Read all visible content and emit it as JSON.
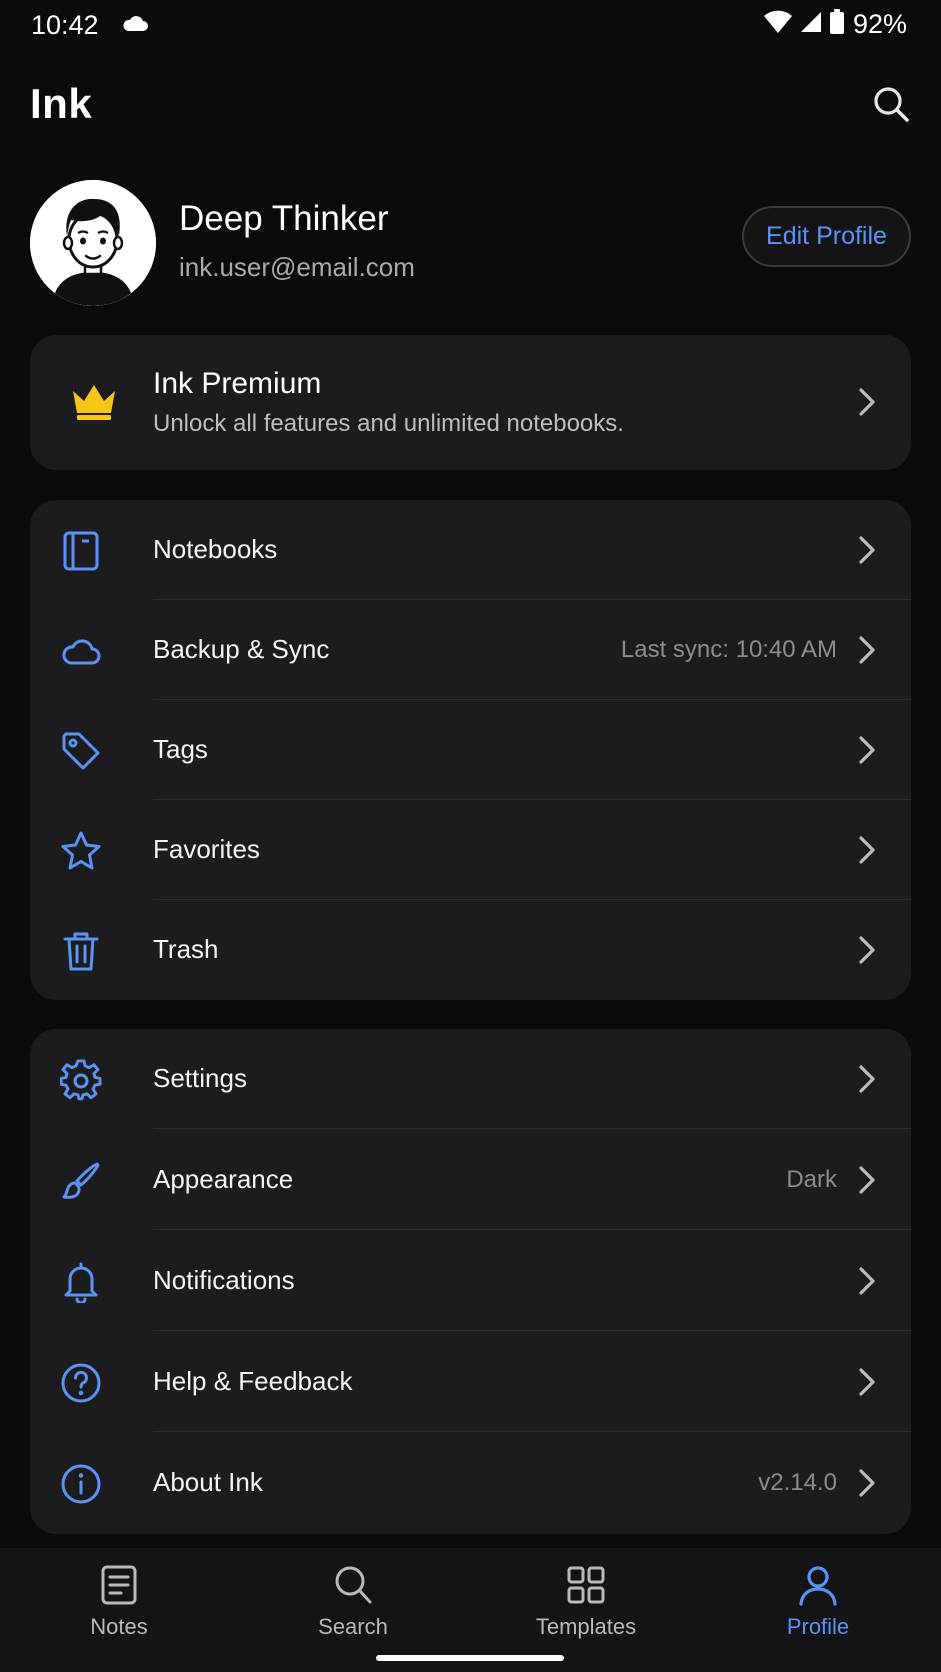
{
  "status_bar": {
    "time": "10:42",
    "battery": "92%"
  },
  "header": {
    "title": "Ink"
  },
  "profile": {
    "name": "Deep Thinker",
    "email": "ink.user@email.com",
    "edit_label": "Edit Profile"
  },
  "premium": {
    "title": "Ink Premium",
    "subtitle": "Unlock all features and unlimited notebooks."
  },
  "library": [
    {
      "label": "Notebooks",
      "value": "",
      "icon": "notebook-icon"
    },
    {
      "label": "Backup & Sync",
      "value": "Last sync: 10:40 AM",
      "icon": "cloud-icon"
    },
    {
      "label": "Tags",
      "value": "",
      "icon": "tag-icon"
    },
    {
      "label": "Favorites",
      "value": "",
      "icon": "star-icon"
    },
    {
      "label": "Trash",
      "value": "",
      "icon": "trash-icon"
    }
  ],
  "settings": [
    {
      "label": "Settings",
      "value": "",
      "icon": "gear-icon"
    },
    {
      "label": "Appearance",
      "value": "Dark",
      "icon": "brush-icon"
    },
    {
      "label": "Notifications",
      "value": "",
      "icon": "bell-icon"
    },
    {
      "label": "Help & Feedback",
      "value": "",
      "icon": "help-icon"
    },
    {
      "label": "About Ink",
      "value": "v2.14.0",
      "icon": "info-icon"
    }
  ],
  "bottom_nav": [
    {
      "label": "Notes",
      "icon": "notes-icon",
      "active": false
    },
    {
      "label": "Search",
      "icon": "search-icon",
      "active": false
    },
    {
      "label": "Templates",
      "icon": "grid-icon",
      "active": false
    },
    {
      "label": "Profile",
      "icon": "person-icon",
      "active": true
    }
  ],
  "colors": {
    "accent": "#5b93f5",
    "background": "#0b0b0d",
    "card": "#1c1c1f",
    "crown": "#f5c518"
  }
}
